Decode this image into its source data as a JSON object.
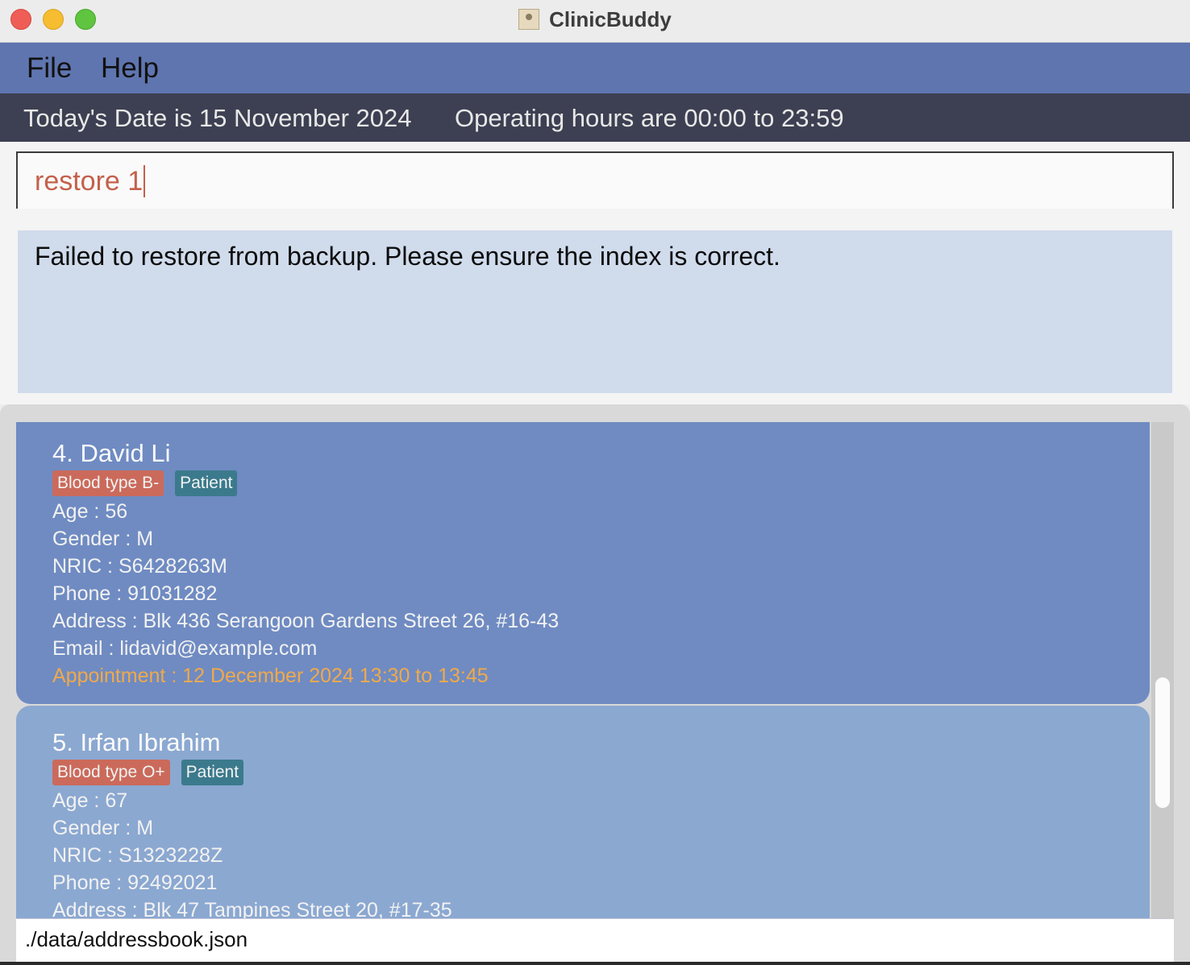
{
  "window": {
    "title": "ClinicBuddy"
  },
  "menu": {
    "file": "File",
    "help": "Help"
  },
  "info": {
    "date": "Today's Date is 15 November 2024",
    "hours": "Operating hours are 00:00 to 23:59"
  },
  "command": {
    "value": "restore 1"
  },
  "result": {
    "message": "Failed to restore from backup. Please ensure the index is correct."
  },
  "patients": [
    {
      "name": "4. David Li",
      "blood_tag": "Blood type B-",
      "role_tag": "Patient",
      "age": "Age : 56",
      "gender": "Gender : M",
      "nric": "NRIC : S6428263M",
      "phone": "Phone : 91031282",
      "address": "Address : Blk 436 Serangoon Gardens Street 26, #16-43",
      "email": "Email : lidavid@example.com",
      "appointment": "Appointment : 12 December 2024 13:30 to 13:45"
    },
    {
      "name": "5. Irfan Ibrahim",
      "blood_tag": "Blood type O+",
      "role_tag": "Patient",
      "age": "Age : 67",
      "gender": "Gender : M",
      "nric": "NRIC : S1323228Z",
      "phone": "Phone : 92492021",
      "address": "Address : Blk 47 Tampines Street 20, #17-35"
    }
  ],
  "status": {
    "file_path": "./data/addressbook.json"
  },
  "colors": {
    "menubar": "#5f75b0",
    "infobar": "#3d4052",
    "selected_card": "#6f8bc2",
    "card": "#8ba8d1",
    "blood_tag": "#cb6a5b",
    "role_tag": "#3b7a8c",
    "appointment": "#f0a94a",
    "command_text": "#c4604b",
    "result_box": "#d0dbec"
  }
}
